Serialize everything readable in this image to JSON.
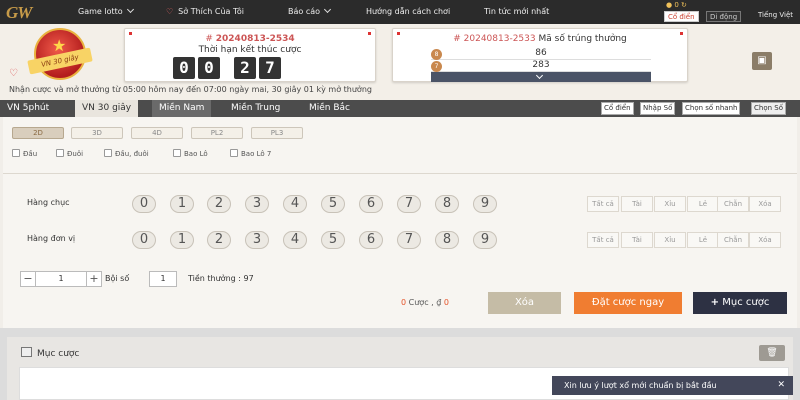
{
  "logo": {
    "text": "GW"
  },
  "nav": {
    "items": [
      {
        "label": "Game lotto",
        "chevron": true
      },
      {
        "label": "Sở Thích Của Tôi",
        "chevron": false
      },
      {
        "label": "Báo cáo",
        "chevron": true
      },
      {
        "label": "Hướng dẫn cách chơi",
        "chevron": false
      },
      {
        "label": "Tin tức mới nhất",
        "chevron": false
      }
    ],
    "counter": "0",
    "mode_classic": "Cổ điển",
    "mode_mobile": "Di động",
    "language": "Tiếng Việt"
  },
  "badge": {
    "text": "VN 30 giây"
  },
  "current_period": {
    "prefix": "#",
    "id": "20240813-2534",
    "countdown_label": "Thời hạn kết thúc cược",
    "digits": [
      "0",
      "0",
      "2",
      "7"
    ]
  },
  "last_result": {
    "prefix": "#",
    "id": "20240813-2533",
    "label": "Mã số trúng thưởng",
    "rows": [
      {
        "pos": "8",
        "value": "86"
      },
      {
        "pos": "7",
        "value": "283"
      }
    ]
  },
  "notice": "Nhận cược và mở thưởng từ 05:00 hôm nay đến 07:00 ngày mai,  30 giây 01 kỳ mở thưởng",
  "tabs": [
    "VN 5phút",
    "VN 30 giây",
    "Miền Nam",
    "Miền Trung",
    "Miền Bắc"
  ],
  "modes": [
    "Cổ điển",
    "Nhập Số",
    "Chọn số nhanh",
    "Chọn Số"
  ],
  "types": [
    "2D",
    "3D",
    "4D",
    "PL2",
    "PL3"
  ],
  "checks": [
    "Đầu",
    "Đuôi",
    "Đầu, đuôi",
    "Bao Lô",
    "Bao Lô 7"
  ],
  "rows": [
    {
      "label": "Hàng chục"
    },
    {
      "label": "Hàng đơn vị"
    }
  ],
  "numbers": [
    "0",
    "1",
    "2",
    "3",
    "4",
    "5",
    "6",
    "7",
    "8",
    "9"
  ],
  "quick_picks": [
    "Tất cả",
    "Tài",
    "Xỉu",
    "Lẻ",
    "Chẵn",
    "Xóa"
  ],
  "stepper": {
    "minus": "−",
    "value": "1",
    "plus": "+"
  },
  "multiplier": {
    "label": "Bội số",
    "value": "1"
  },
  "prize": {
    "label": "Tiền thưởng :",
    "value": "97"
  },
  "bet_summary": {
    "count": "0",
    "count_label": "Cược ,",
    "currency": "₫",
    "amount": "0"
  },
  "buttons": {
    "clear": "Xóa",
    "order": "Đặt cược ngay",
    "add": "Mục cược"
  },
  "bet_list": {
    "title": "Mục cược"
  },
  "toast": {
    "message": "Xin lưu ý lượt xổ mới chuẩn bị bắt đầu",
    "close": "✕"
  },
  "colors": {
    "accent": "#f07d31",
    "dark": "#2d3143",
    "nav": "#2b2b2b",
    "tabbar": "#4c4c4c",
    "highlight": "#c55"
  }
}
